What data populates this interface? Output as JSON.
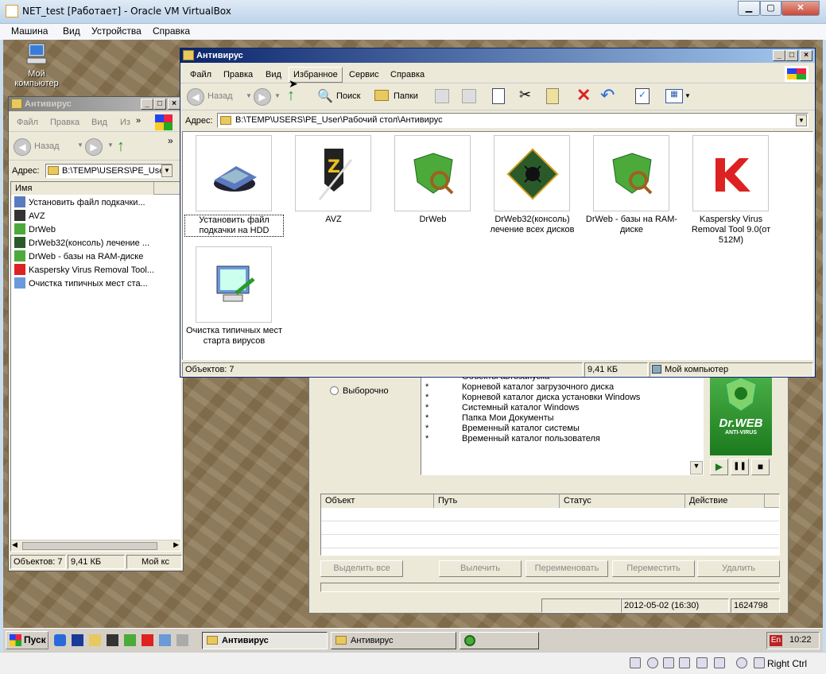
{
  "host": {
    "title": "NET_test [Работает] - Oracle VM VirtualBox",
    "menu": [
      "Машина",
      "Вид",
      "Устройства",
      "Справка"
    ],
    "status_right": "Right Ctrl"
  },
  "desktop": {
    "my_computer_label_1": "Мой",
    "my_computer_label_2": "компьютер"
  },
  "small_window": {
    "title": "Антивирус",
    "menu": [
      "Файл",
      "Правка",
      "Вид",
      "Из"
    ],
    "back_label": "Назад",
    "address_label": "Адрес:",
    "address_value": "B:\\TEMP\\USERS\\PE_User\\",
    "column_name": "Имя",
    "items": [
      "Установить файл подкачки...",
      "AVZ",
      "DrWeb",
      "DrWeb32(консоль) лечение ...",
      "DrWeb - базы на RAM-диске",
      "Kaspersky Virus Removal Tool...",
      "Очистка типичных мест ста..."
    ],
    "status_objects": "Объектов: 7",
    "status_size": "9,41 КБ",
    "status_location": "Мой кс"
  },
  "main_window": {
    "title": "Антивирус",
    "menu": [
      "Файл",
      "Правка",
      "Вид",
      "Избранное",
      "Сервис",
      "Справка"
    ],
    "toolbar": {
      "back": "Назад",
      "search": "Поиск",
      "folders": "Папки"
    },
    "address_label": "Адрес:",
    "address_value": "B:\\TEMP\\USERS\\PE_User\\Рабочий стол\\Антивирус",
    "icons": [
      {
        "label": "Установить файл подкачки на HDD",
        "icon": "drive-icon"
      },
      {
        "label": "AVZ",
        "icon": "avz-icon"
      },
      {
        "label": "DrWeb",
        "icon": "drweb-icon"
      },
      {
        "label": "DrWeb32(консоль) лечение всех дисков",
        "icon": "drweb-console-icon"
      },
      {
        "label": "DrWeb - базы на RAM-диске",
        "icon": "drweb-icon"
      },
      {
        "label": "Kaspersky Virus Removal Tool 9.0(от 512М)",
        "icon": "kaspersky-icon"
      },
      {
        "label": "Очистка типичных мест старта вирусов",
        "icon": "cleanup-icon"
      }
    ],
    "status_objects": "Объектов: 7",
    "status_size": "9,41 КБ",
    "status_location": "Мой компьютер"
  },
  "drweb_window": {
    "radio_selective": "Выборочно",
    "paths": [
      "Объекты автозапуска",
      "Корневой каталог загрузочного диска",
      "Корневой каталог диска установки Windows",
      "Системный каталог Windows",
      "Папка Мои Документы",
      "Временный каталог системы",
      "Временный каталог пользователя"
    ],
    "logo_text": "Dr.WEB",
    "logo_sub": "ANTI-VIRUS",
    "columns": [
      "Объект",
      "Путь",
      "Статус",
      "Действие"
    ],
    "buttons": {
      "select_all": "Выделить все",
      "cure": "Вылечить",
      "rename": "Переименовать",
      "move": "Переместить",
      "delete": "Удалить"
    },
    "status_date": "2012-05-02 (16:30)",
    "status_count": "1624798"
  },
  "taskbar": {
    "start": "Пуск",
    "tasks": [
      "Антивирус",
      "Антивирус"
    ],
    "lang": "En",
    "clock": "10:22"
  }
}
